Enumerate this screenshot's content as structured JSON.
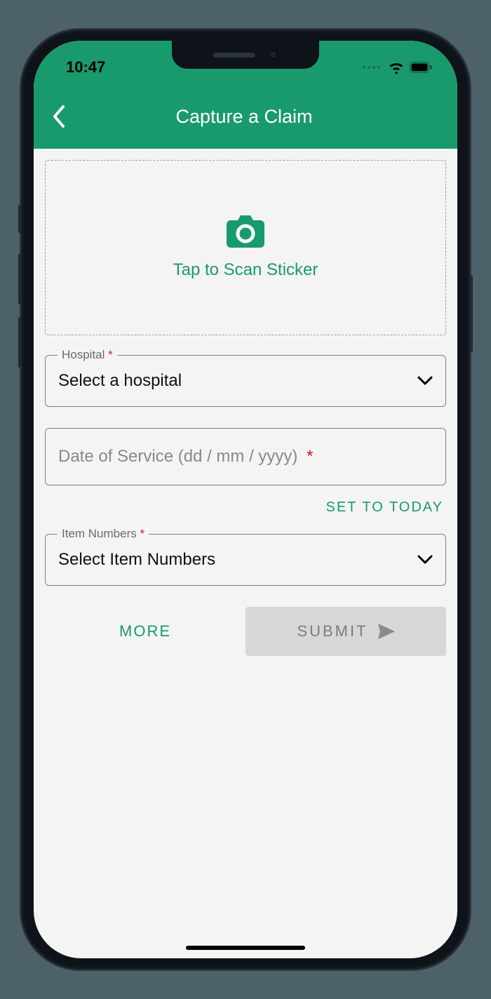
{
  "statusbar": {
    "time": "10:47"
  },
  "header": {
    "title": "Capture a Claim"
  },
  "scan": {
    "label": "Tap to Scan Sticker"
  },
  "hospital": {
    "label": "Hospital",
    "required_marker": "*",
    "placeholder": "Select a hospital"
  },
  "date": {
    "placeholder": "Date of Service (dd / mm / yyyy)",
    "required_marker": "*",
    "set_today": "SET TO TODAY"
  },
  "items": {
    "label": "Item Numbers",
    "required_marker": "*",
    "placeholder": "Select Item Numbers"
  },
  "buttons": {
    "more": "MORE",
    "submit": "SUBMIT"
  }
}
